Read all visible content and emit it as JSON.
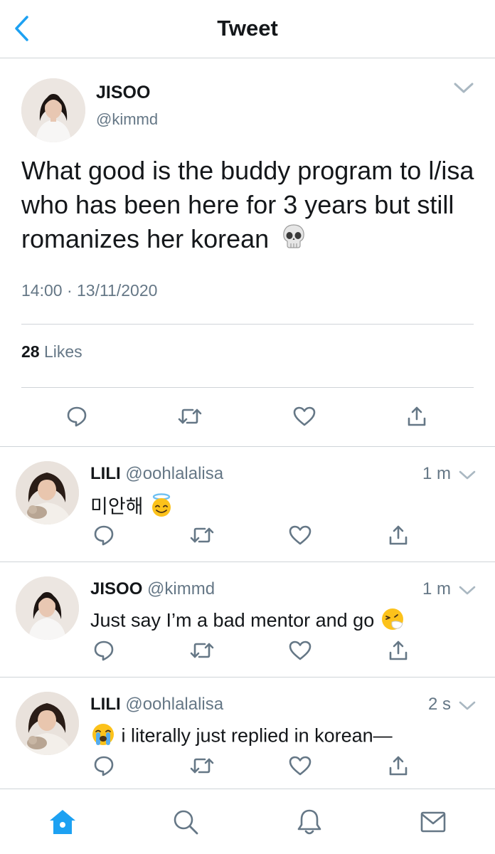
{
  "header": {
    "title": "Tweet"
  },
  "main_tweet": {
    "name": "JISOO",
    "handle": "@kimmd",
    "text": "What good is the buddy program to l/isa who has been here for 3 years but still romanizes her korean",
    "emoji": "skull",
    "timestamp": "14:00 · 13/11/2020",
    "likes_count": "28",
    "likes_label": "Likes"
  },
  "replies": [
    {
      "name": "LILI",
      "handle": "@oohlalalisa",
      "time": "1 m",
      "text": "미안해",
      "emoji": "smiling-face-with-halo"
    },
    {
      "name": "JISOO",
      "handle": "@kimmd",
      "time": "1 m",
      "text": "Just say I’m a bad mentor and go",
      "emoji": "sneezing-face"
    },
    {
      "name": "LILI",
      "handle": "@oohlalalisa",
      "time": "2 s",
      "text": "i literally just replied in korean—",
      "emoji": "loudly-crying-face"
    }
  ],
  "nav": [
    "home-icon",
    "search-icon",
    "notifications-icon",
    "messages-icon"
  ],
  "colors": {
    "accent": "#1da1f2",
    "icon_gray": "#657786",
    "divider": "#cfd4d8"
  }
}
